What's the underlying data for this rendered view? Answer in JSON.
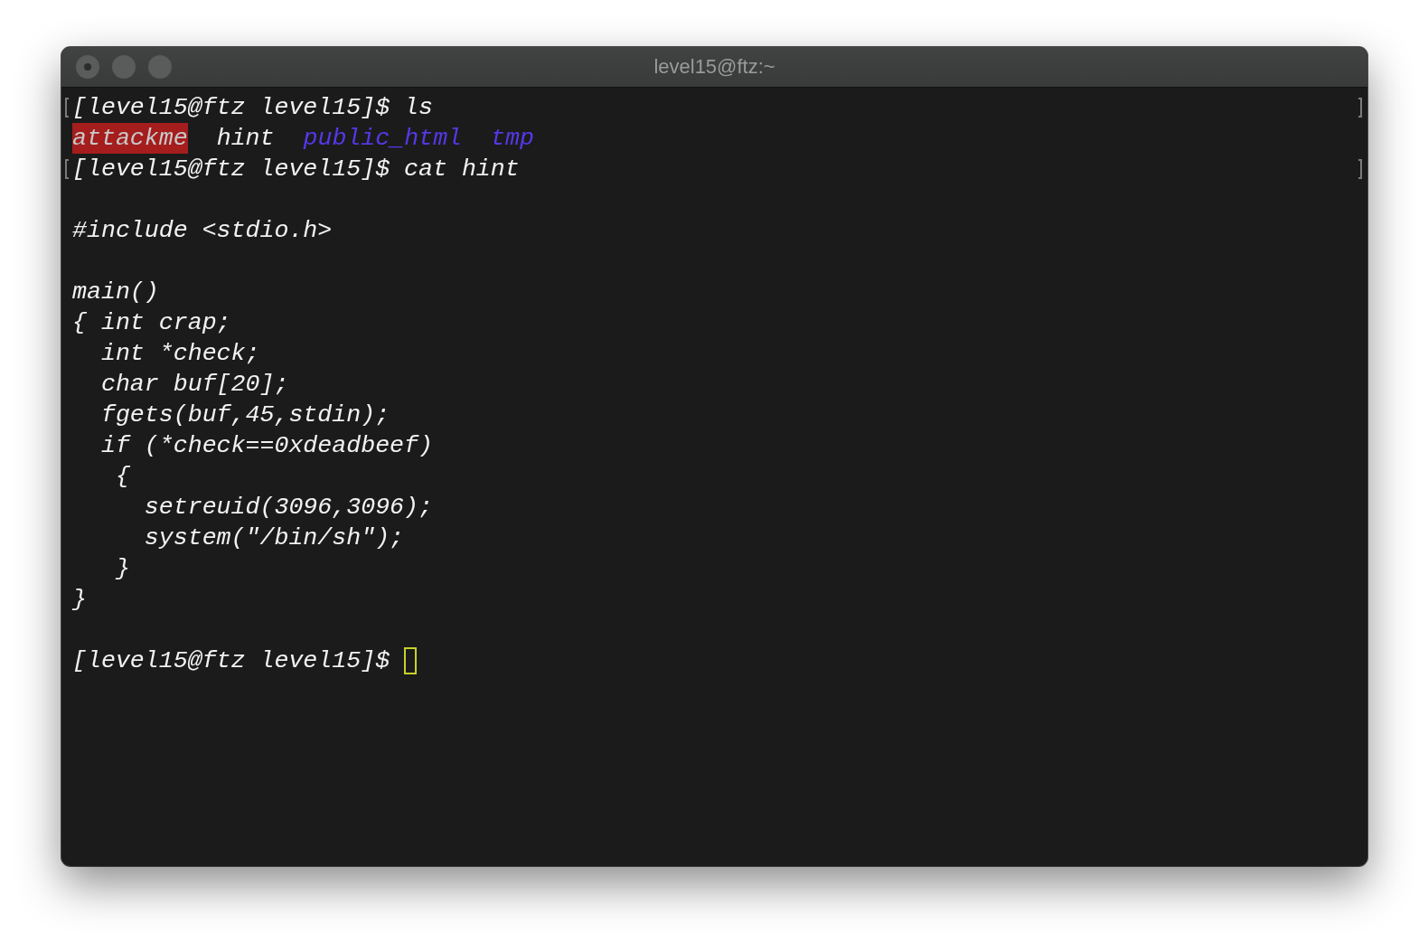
{
  "window": {
    "title": "level15@ftz:~"
  },
  "lines": [
    {
      "text": "[level15@ftz level15]$ ls",
      "marked": true
    },
    {
      "entries": [
        {
          "name": "attackme",
          "kind": "executable"
        },
        {
          "name": "hint",
          "kind": "file"
        },
        {
          "name": "public_html",
          "kind": "directory"
        },
        {
          "name": "tmp",
          "kind": "directory"
        }
      ]
    },
    {
      "text": "[level15@ftz level15]$ cat hint",
      "marked": true
    },
    {
      "text": "#include <stdio.h>",
      "blank_before": true
    },
    {
      "text": "main()",
      "blank_before": true
    },
    {
      "text": "{ int crap;"
    },
    {
      "text": "  int *check;"
    },
    {
      "text": "  char buf[20];"
    },
    {
      "text": "  fgets(buf,45,stdin);"
    },
    {
      "text": "  if (*check==0xdeadbeef)"
    },
    {
      "text": "   {"
    },
    {
      "text": "     setreuid(3096,3096);"
    },
    {
      "text": "     system(\"/bin/sh\");"
    },
    {
      "text": "   }"
    },
    {
      "text": "}"
    },
    {
      "text": "[level15@ftz level15]$",
      "blank_before": true,
      "cursor": true
    }
  ]
}
